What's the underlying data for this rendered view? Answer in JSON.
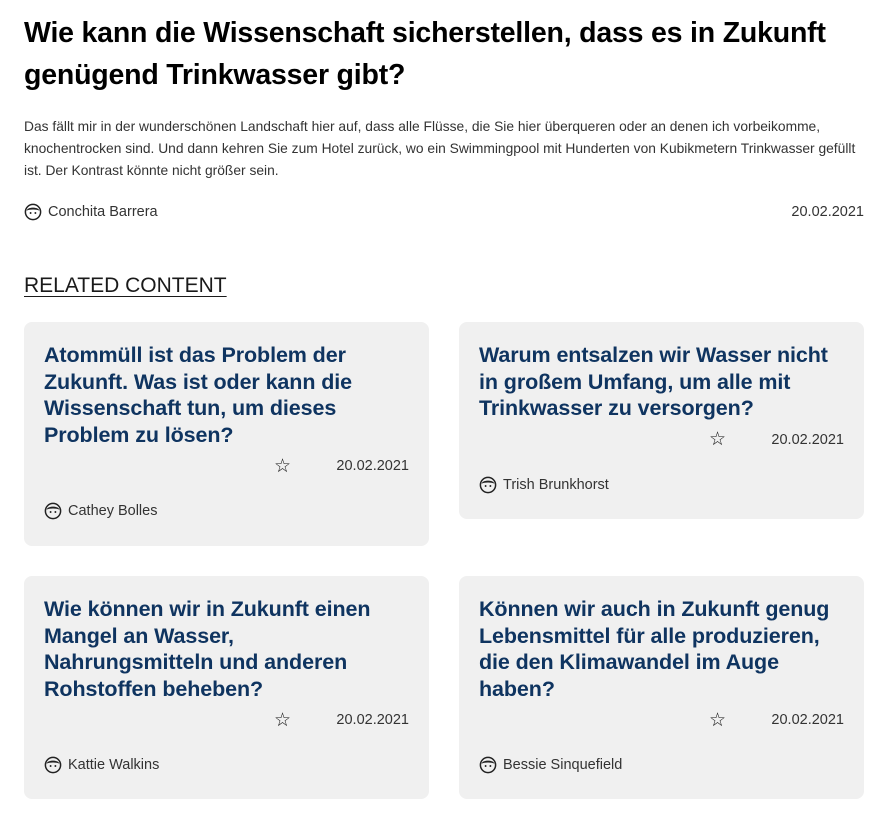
{
  "question": {
    "title": "Wie kann die Wissenschaft sicherstellen, dass es in Zukunft genügend Trinkwasser gibt?",
    "body": "Das fällt mir in der wunderschönen Landschaft hier auf, dass alle Flüsse, die Sie hier überqueren oder an denen ich vorbeikomme, knochentrocken sind. Und dann kehren Sie zum Hotel zurück, wo ein Swimmingpool mit Hunderten von Kubikmetern Trinkwasser gefüllt ist. Der Kontrast könnte nicht größer sein.",
    "author": "Conchita Barrera",
    "author_icon": "user-avatar-icon",
    "date": "20.02.2021"
  },
  "related": {
    "heading": "RELATED CONTENT",
    "cards": [
      {
        "title": "Atommüll ist das Problem der Zukunft. Was ist oder kann die Wissenschaft tun, um dieses Problem zu lösen?",
        "date": "20.02.2021",
        "author": "Cathey Bolles",
        "star_icon": "star-outline-icon",
        "star_glyph": "☆"
      },
      {
        "title": "Warum entsalzen wir Wasser nicht in großem Umfang, um alle mit Trinkwasser zu versorgen?",
        "date": "20.02.2021",
        "author": "Trish Brunkhorst",
        "star_icon": "star-outline-icon",
        "star_glyph": "☆"
      },
      {
        "title": "Wie können wir in Zukunft einen Mangel an Wasser, Nahrungsmitteln und anderen Rohstoffen beheben?",
        "date": "20.02.2021",
        "author": "Kattie Walkins",
        "star_icon": "star-outline-icon",
        "star_glyph": "☆"
      },
      {
        "title": "Können wir auch in Zukunft genug Lebensmittel für alle produzieren, die den Klimawandel im Auge haben?",
        "date": "20.02.2021",
        "author": "Bessie Sinquefield",
        "star_icon": "star-outline-icon",
        "star_glyph": "☆"
      }
    ]
  },
  "colors": {
    "card_background": "#f0f0f0",
    "card_title": "#0f3460",
    "text": "#1a1a1a"
  }
}
